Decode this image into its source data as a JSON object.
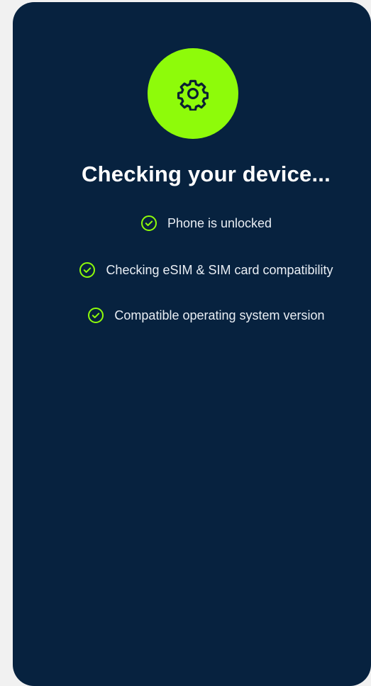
{
  "status": {
    "title": "Checking your device...",
    "badge_icon": "gear-icon",
    "accent_color": "#8efb0a",
    "background_color": "#07223f"
  },
  "checks": [
    {
      "label": "Phone is unlocked",
      "icon": "check-circle-icon",
      "state": "passed"
    },
    {
      "label": "Checking eSIM & SIM card compatibility",
      "icon": "check-circle-icon",
      "state": "passed"
    },
    {
      "label": "Compatible operating system version",
      "icon": "check-circle-icon",
      "state": "passed"
    }
  ]
}
